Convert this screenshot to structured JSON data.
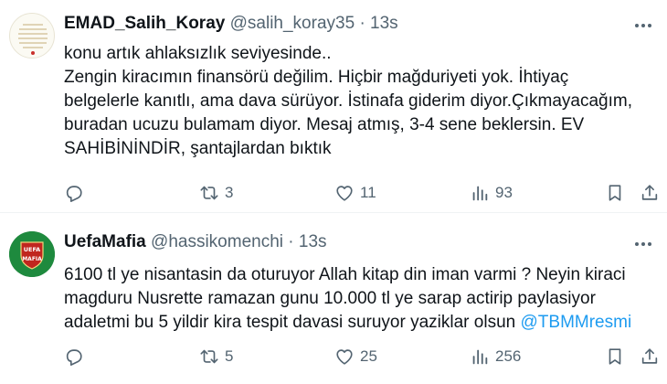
{
  "tweets": [
    {
      "author": "EMAD_Salih_Koray",
      "handle": "@salih_koray35",
      "separator": "·",
      "time": "13s",
      "lines": [
        "konu artık ahlaksızlık seviyesinde..",
        "Zengin kiracımın finansörü değilim. Hiçbir mağduriyeti yok. İhtiyaç",
        "belgelerle kanıtlı, ama dava sürüyor. İstinafa giderim diyor.Çıkmayacağım,",
        "buradan ucuzu bulamam diyor. Mesaj atmış, 3-4 sene beklersin. EV",
        "SAHİBİNİNDİR, şantajlardan bıktık"
      ],
      "counts": {
        "reply": "",
        "retweet": "3",
        "like": "11",
        "views": "93"
      }
    },
    {
      "author": "UefaMafia",
      "handle": "@hassikomenchi",
      "separator": "·",
      "time": "13s",
      "avatar_text": "UEFA MAFIA",
      "lines": [
        "6100 tl ye nisantasin da oturuyor Allah kitap din iman varmi ? Neyin kiraci",
        "magduru Nusrette ramazan gunu 10.000 tl ye sarap actirip paylasiyor",
        "adaletmi bu 5 yildir kira tespit davasi suruyor yaziklar olsun "
      ],
      "mention": "@TBMMresmi",
      "counts": {
        "reply": "",
        "retweet": "5",
        "like": "25",
        "views": "256"
      }
    }
  ],
  "colors": {
    "text": "#0f1419",
    "secondary": "#536471",
    "link": "#1d9bf0",
    "divider": "#eff3f4"
  },
  "icons": [
    "more-icon",
    "reply-icon",
    "retweet-icon",
    "like-icon",
    "views-icon",
    "bookmark-icon",
    "share-icon"
  ]
}
